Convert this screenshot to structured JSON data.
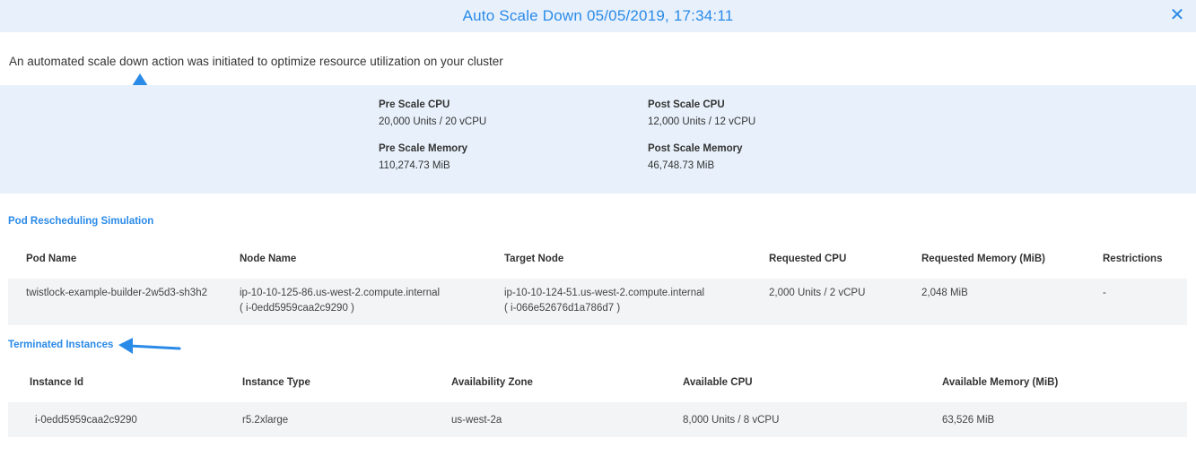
{
  "header": {
    "title": "Auto Scale Down 05/05/2019, 17:34:11",
    "close_icon": "close-icon",
    "accent_color": "#2a8ae8",
    "background_color": "#e8f1fb"
  },
  "intro_text": "An automated scale down action was initiated to optimize resource utilization on your cluster",
  "stats": {
    "pre_cpu_label": "Pre Scale CPU",
    "pre_cpu_value": "20,000 Units / 20 vCPU",
    "post_cpu_label": "Post Scale CPU",
    "post_cpu_value": "12,000 Units / 12 vCPU",
    "pre_memory_label": "Pre Scale Memory",
    "pre_memory_value": "110,274.73 MiB",
    "post_memory_label": "Post Scale Memory",
    "post_memory_value": "46,748.73 MiB"
  },
  "pods": {
    "title": "Pod Rescheduling Simulation",
    "columns": [
      "Pod Name",
      "Node Name",
      "Target Node",
      "Requested CPU",
      "Requested Memory (MiB)",
      "Restrictions"
    ],
    "rows": [
      {
        "pod_name": "twistlock-example-builder-2w5d3-sh3h2",
        "node_name": "ip-10-10-125-86.us-west-2.compute.internal",
        "node_id": "( i-0edd5959caa2c9290 )",
        "target_node": "ip-10-10-124-51.us-west-2.compute.internal",
        "target_id": "( i-066e52676d1a786d7 )",
        "requested_cpu": "2,000 Units / 2 vCPU",
        "requested_memory": "2,048 MiB",
        "restrictions": "-"
      }
    ]
  },
  "instances": {
    "title": "Terminated Instances",
    "columns": [
      "Instance Id",
      "Instance Type",
      "Availability Zone",
      "Available CPU",
      "Available Memory (MiB)"
    ],
    "rows": [
      {
        "instance_id": "i-0edd5959caa2c9290",
        "instance_type": "r5.2xlarge",
        "availability_zone": "us-west-2a",
        "available_cpu": "8,000 Units / 8 vCPU",
        "available_memory": "63,526 MiB"
      }
    ]
  },
  "annotation_color": "#2a8ae8"
}
